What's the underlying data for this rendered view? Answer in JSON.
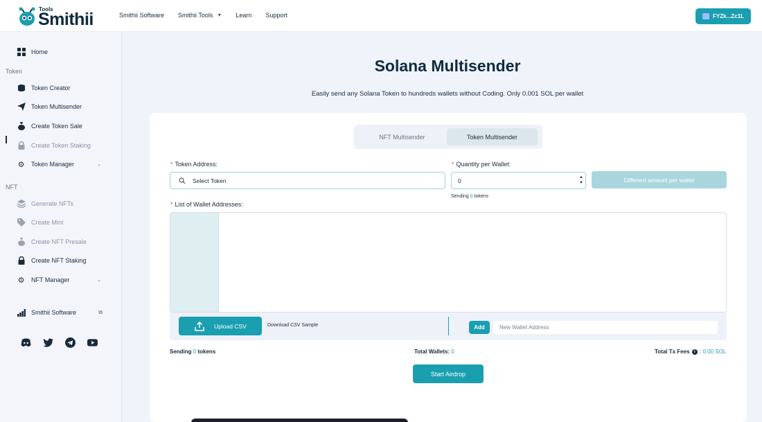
{
  "header": {
    "logo_tools": "Tools",
    "logo_name": "Smithii",
    "nav": [
      {
        "label": "Smithii Software",
        "has_dropdown": false
      },
      {
        "label": "Smithii Tools",
        "has_dropdown": true
      },
      {
        "label": "Learn",
        "has_dropdown": false
      },
      {
        "label": "Support",
        "has_dropdown": false
      }
    ],
    "wallet_label": "FYZk...Zc1L"
  },
  "sidebar": {
    "home": "Home",
    "section_token": "Token",
    "token_items": [
      {
        "label": "Token Creator",
        "icon": "coins-icon",
        "disabled": false
      },
      {
        "label": "Token Multisender",
        "icon": "paper-plane-icon",
        "disabled": false,
        "active": true
      },
      {
        "label": "Create Token Sale",
        "icon": "money-bag-icon",
        "disabled": false
      },
      {
        "label": "Create Token Staking",
        "icon": "lock-icon",
        "disabled": true
      },
      {
        "label": "Token Manager",
        "icon": "gear-icon",
        "disabled": false,
        "has_dropdown": true
      }
    ],
    "section_nft": "NFT",
    "nft_items": [
      {
        "label": "Generate NFTs",
        "icon": "layers-icon",
        "disabled": true
      },
      {
        "label": "Create Mint",
        "icon": "tag-icon",
        "disabled": true
      },
      {
        "label": "Create NFT Presale",
        "icon": "money-bag-icon",
        "disabled": true
      },
      {
        "label": "Create NFT Staking",
        "icon": "lock-icon",
        "disabled": false
      },
      {
        "label": "NFT Manager",
        "icon": "gear-icon",
        "disabled": false,
        "has_dropdown": true
      }
    ],
    "software": "Smithii Software",
    "socials": [
      "discord-icon",
      "twitter-icon",
      "telegram-icon",
      "youtube-icon"
    ]
  },
  "main": {
    "title": "Solana Multisender",
    "subtitle": "Easily send any Solana Token to hundreds wallets without Coding. Only 0.001 SOL per wallet",
    "tabs": [
      {
        "label": "NFT Multisender",
        "active": false
      },
      {
        "label": "Token Multisender",
        "active": true
      }
    ],
    "token_address_label": "Token Address:",
    "token_placeholder": "Select Token",
    "quantity_label": "Quantity per Wallet:",
    "quantity_value": "0",
    "different_amount_label": "Different amount per wallet",
    "sending_small_prefix": "Sending",
    "sending_small_value": "0",
    "sending_small_suffix": "tokens",
    "list_label": "List of Wallet Addresses:",
    "upload_label": "Upload CSV",
    "download_label": "Download CSV Sample",
    "add_label": "Add",
    "new_wallet_placeholder": "New Wallet Address",
    "stats": {
      "sending_prefix": "Sending",
      "sending_value": "0",
      "sending_suffix": "tokens",
      "total_wallets_label": "Total Wallets:",
      "total_wallets_value": "0",
      "fees_label": "Total Tx Fees",
      "fees_value": "0.00 SOL"
    },
    "airdrop_label": "Start Airdrop"
  },
  "colors": {
    "accent": "#1a9fb0",
    "accent_disabled": "#a9d6dd",
    "dark": "#0d2b3e"
  }
}
